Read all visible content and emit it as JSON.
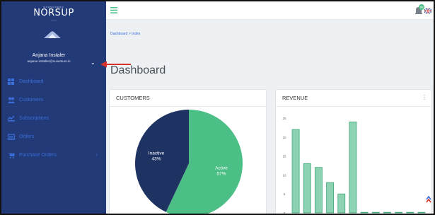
{
  "brand": {
    "dots": "ooooooooo",
    "name": "NORSUP",
    "tag": "———"
  },
  "user": {
    "name": "Anjana Instaler",
    "email": "anjana+installer@nuventure.in",
    "toggle": "⌄"
  },
  "sidebar": {
    "items": [
      {
        "label": "Dashboard",
        "icon": "dashboard-icon"
      },
      {
        "label": "Customers",
        "icon": "users-icon"
      },
      {
        "label": "Subscriptions",
        "icon": "subscriptions-icon"
      },
      {
        "label": "Orders",
        "icon": "orders-icon"
      },
      {
        "label": "Purchase Orders",
        "icon": "cart-icon",
        "caret": "›"
      }
    ]
  },
  "breadcrumb": {
    "text": "Dashboard > Index"
  },
  "page": {
    "title": "Dashboard"
  },
  "cards": {
    "customers": {
      "title": "CUSTOMERS"
    },
    "revenue": {
      "title": "REVENUE",
      "menu": "⋮"
    }
  },
  "notifications": {
    "count": "99"
  },
  "colors": {
    "sidebar": "#233a78",
    "accent_green": "#4bbf85",
    "navy_slice": "#1f3363",
    "bar_fill": "#8dd3b3",
    "bar_stroke": "#3fa877",
    "link_blue": "#3a6ed8"
  },
  "chart_data": [
    {
      "type": "pie",
      "title": "CUSTOMERS",
      "slices": [
        {
          "label": "Active",
          "value": 57,
          "display": "57%",
          "color": "#4bbf85"
        },
        {
          "label": "Inactive",
          "value": 43,
          "display": "43%",
          "color": "#1f3363"
        }
      ]
    },
    {
      "type": "bar",
      "title": "REVENUE",
      "ylim": [
        0,
        25
      ],
      "yticks": [
        0,
        5,
        10,
        15,
        20,
        25
      ],
      "values": [
        22,
        13,
        12,
        8,
        5,
        24,
        0,
        0,
        0,
        0,
        0,
        0
      ],
      "grid": false
    }
  ]
}
